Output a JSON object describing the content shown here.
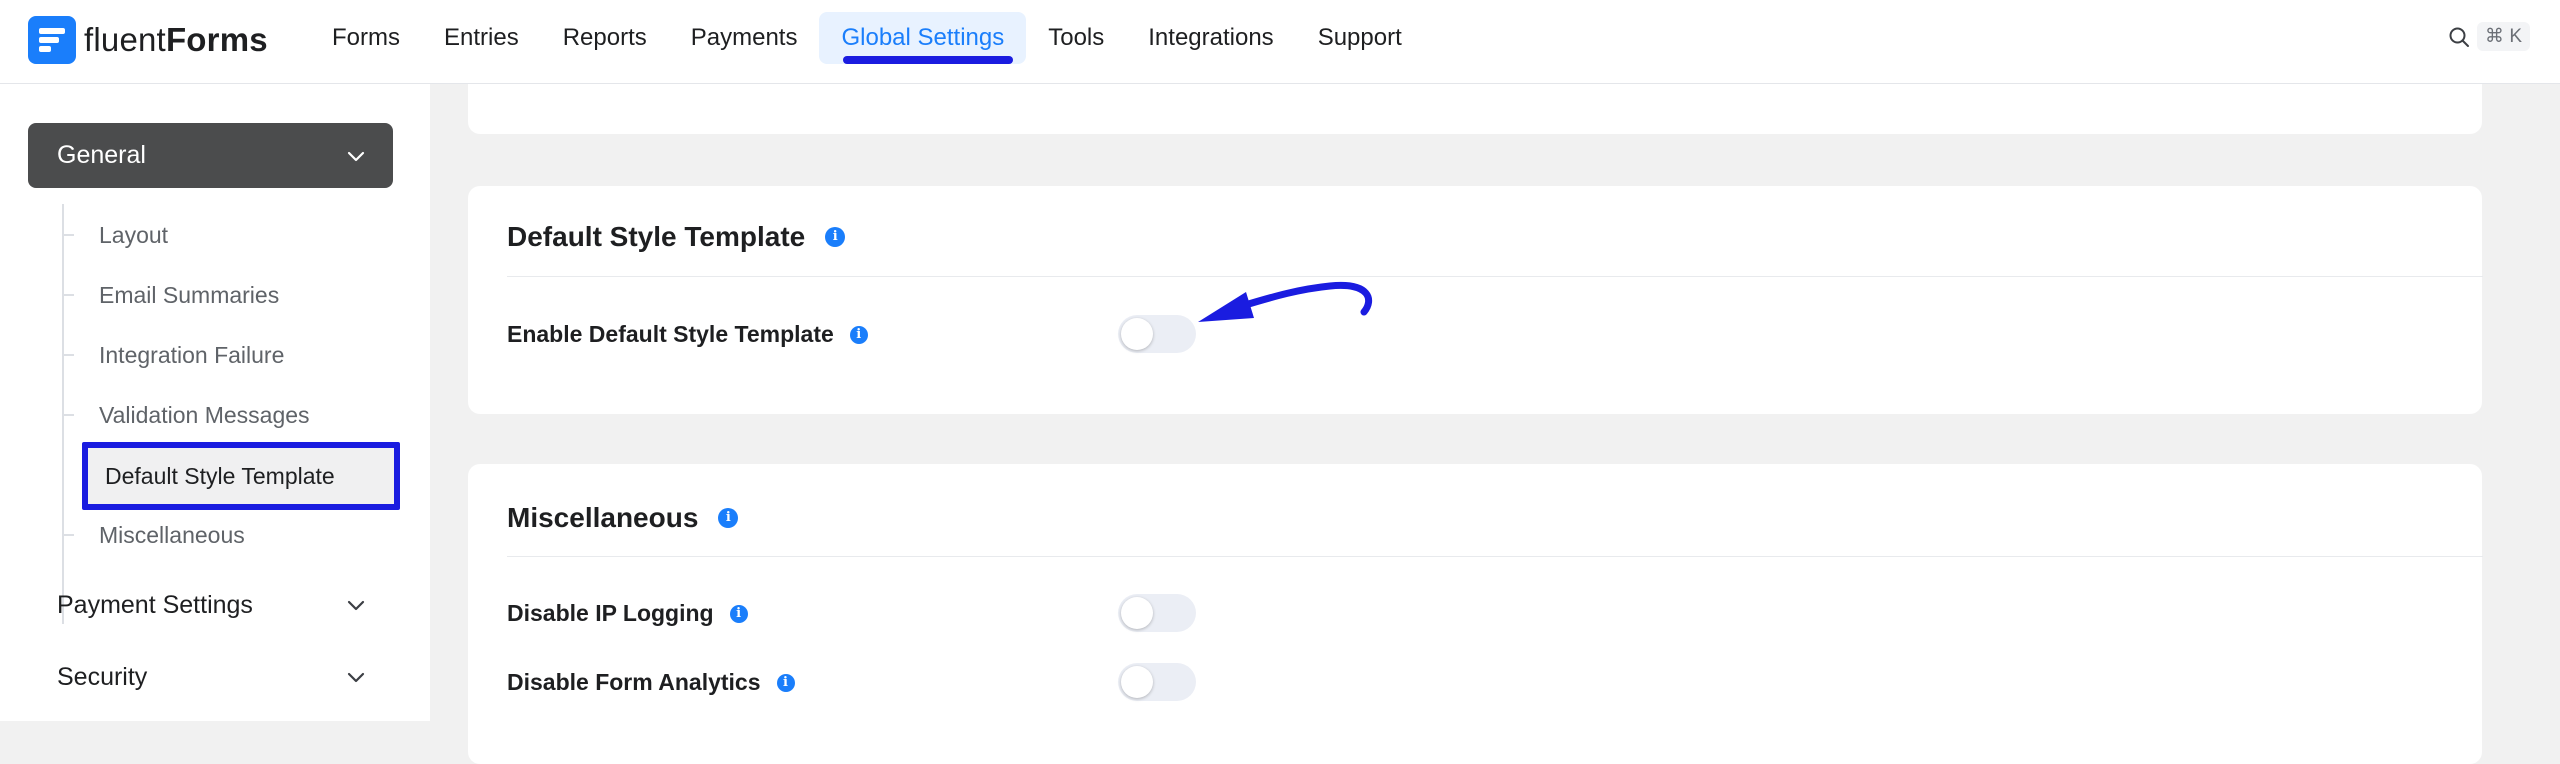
{
  "brand": {
    "name_light": "fluent",
    "name_bold": "Forms"
  },
  "nav": {
    "items": [
      {
        "label": "Forms"
      },
      {
        "label": "Entries"
      },
      {
        "label": "Reports"
      },
      {
        "label": "Payments"
      },
      {
        "label": "Global Settings"
      },
      {
        "label": "Tools"
      },
      {
        "label": "Integrations"
      },
      {
        "label": "Support"
      }
    ],
    "active": "Global Settings",
    "search_shortcut": "⌘ K"
  },
  "sidebar": {
    "group": "General",
    "items": [
      {
        "label": "Layout"
      },
      {
        "label": "Email Summaries"
      },
      {
        "label": "Integration Failure"
      },
      {
        "label": "Validation Messages"
      },
      {
        "label": "Default Style Template"
      },
      {
        "label": "Miscellaneous"
      }
    ],
    "active_item": "Default Style Template",
    "sections": [
      {
        "label": "Payment Settings"
      },
      {
        "label": "Security"
      }
    ]
  },
  "main": {
    "style_card": {
      "title": "Default Style Template",
      "rows": [
        {
          "label": "Enable Default Style Template",
          "enabled": false
        }
      ]
    },
    "misc_card": {
      "title": "Miscellaneous",
      "rows": [
        {
          "label": "Disable IP Logging",
          "enabled": false
        },
        {
          "label": "Disable Form Analytics",
          "enabled": false
        }
      ]
    }
  },
  "colors": {
    "accent": "#1a7efb",
    "annotation": "#1a1ce0",
    "sidebar_active_bg": "#4b4c4d"
  }
}
